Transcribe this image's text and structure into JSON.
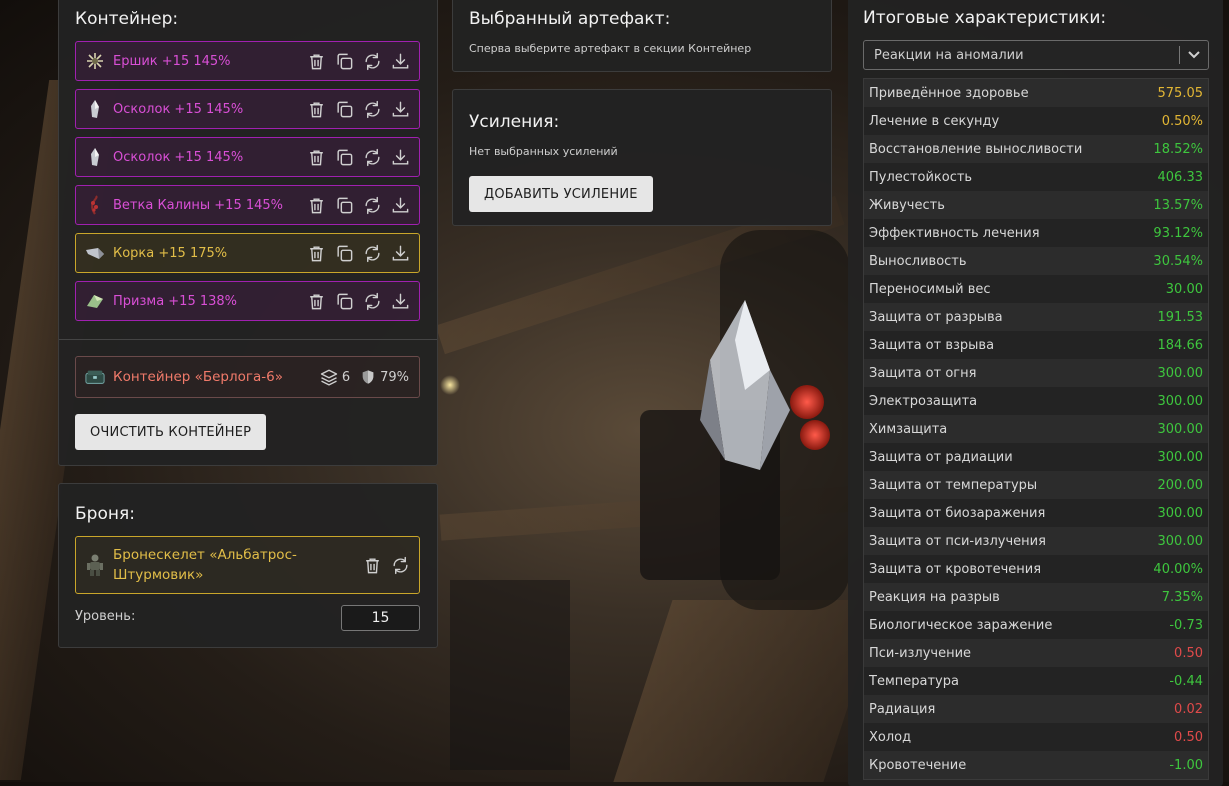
{
  "colors": {
    "legendary": "#d94fd6",
    "gold": "#e2be48",
    "positive": "#3ec63e",
    "negative": "#e04a4a",
    "neutral_gold": "#e2b634"
  },
  "container": {
    "title": "Контейнер:",
    "artifacts": [
      {
        "name": "Ершик +15 145%",
        "rarity": "purple",
        "icon": "spiky-artifact-icon"
      },
      {
        "name": "Осколок +15 145%",
        "rarity": "purple",
        "icon": "shard-artifact-icon"
      },
      {
        "name": "Осколок +15 145%",
        "rarity": "purple",
        "icon": "shard-artifact-icon"
      },
      {
        "name": "Ветка Калины +15 145%",
        "rarity": "purple",
        "icon": "branch-artifact-icon"
      },
      {
        "name": "Корка +15 175%",
        "rarity": "gold",
        "icon": "crust-artifact-icon"
      },
      {
        "name": "Призма +15 138%",
        "rarity": "purple",
        "icon": "prism-artifact-icon"
      }
    ],
    "container_item": {
      "name": "Контейнер «Берлога-6»",
      "slots": "6",
      "protection": "79%"
    },
    "clear_label": "ОЧИСТИТЬ КОНТЕЙНЕР"
  },
  "armor": {
    "title": "Броня:",
    "name_line1": "Бронескелет «Альбатрос-",
    "name_line2": "Штурмовик»",
    "level_label": "Уровень:",
    "level_value": "15"
  },
  "selected": {
    "title": "Выбранный артефакт:",
    "hint": "Сперва выберите артефакт в секции Контейнер"
  },
  "boosts": {
    "title": "Усиления:",
    "hint": "Нет выбранных усилений",
    "add_label": "ДОБАВИТЬ УСИЛЕНИЕ"
  },
  "totals": {
    "title": "Итоговые характеристики:",
    "select_value": "Реакции на аномалии",
    "rows": [
      {
        "label": "Приведённое здоровье",
        "value": "575.05",
        "tone": "gold"
      },
      {
        "label": "Лечение в секунду",
        "value": "0.50%",
        "tone": "gold"
      },
      {
        "label": "Восстановление выносливости",
        "value": "18.52%",
        "tone": "pos"
      },
      {
        "label": "Пулестойкость",
        "value": "406.33",
        "tone": "pos"
      },
      {
        "label": "Живучесть",
        "value": "13.57%",
        "tone": "pos"
      },
      {
        "label": "Эффективность лечения",
        "value": "93.12%",
        "tone": "pos"
      },
      {
        "label": "Выносливость",
        "value": "30.54%",
        "tone": "pos"
      },
      {
        "label": "Переносимый вес",
        "value": "30.00",
        "tone": "pos"
      },
      {
        "label": "Защита от разрыва",
        "value": "191.53",
        "tone": "pos"
      },
      {
        "label": "Защита от взрыва",
        "value": "184.66",
        "tone": "pos"
      },
      {
        "label": "Защита от огня",
        "value": "300.00",
        "tone": "pos"
      },
      {
        "label": "Электрозащита",
        "value": "300.00",
        "tone": "pos"
      },
      {
        "label": "Химзащита",
        "value": "300.00",
        "tone": "pos"
      },
      {
        "label": "Защита от радиации",
        "value": "300.00",
        "tone": "pos"
      },
      {
        "label": "Защита от температуры",
        "value": "200.00",
        "tone": "pos"
      },
      {
        "label": "Защита от биозаражения",
        "value": "300.00",
        "tone": "pos"
      },
      {
        "label": "Защита от пси-излучения",
        "value": "300.00",
        "tone": "pos"
      },
      {
        "label": "Защита от кровотечения",
        "value": "40.00%",
        "tone": "pos"
      },
      {
        "label": "Реакция на разрыв",
        "value": "7.35%",
        "tone": "pos"
      },
      {
        "label": "Биологическое заражение",
        "value": "-0.73",
        "tone": "pos"
      },
      {
        "label": "Пси-излучение",
        "value": "0.50",
        "tone": "neg"
      },
      {
        "label": "Температура",
        "value": "-0.44",
        "tone": "pos"
      },
      {
        "label": "Радиация",
        "value": "0.02",
        "tone": "neg"
      },
      {
        "label": "Холод",
        "value": "0.50",
        "tone": "neg"
      },
      {
        "label": "Кровотечение",
        "value": "-1.00",
        "tone": "pos"
      }
    ]
  }
}
